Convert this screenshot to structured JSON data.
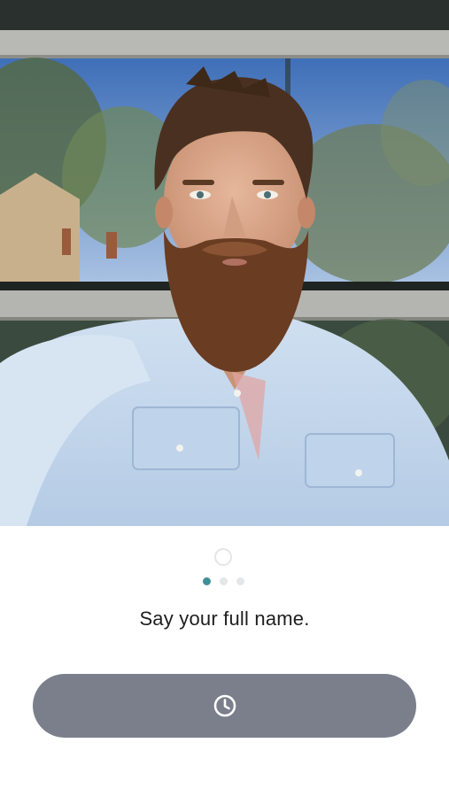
{
  "camera": {
    "description_icon": "selfie-camera-feed"
  },
  "progress": {
    "steps_total": 3,
    "current_step": 1
  },
  "prompt": {
    "text": "Say your full name."
  },
  "action_button": {
    "icon": "clock-icon",
    "state": "disabled"
  },
  "colors": {
    "button_bg": "#7a7f8b",
    "active_dot": "#3f8f96",
    "inactive_dot": "#e4e6e8"
  }
}
